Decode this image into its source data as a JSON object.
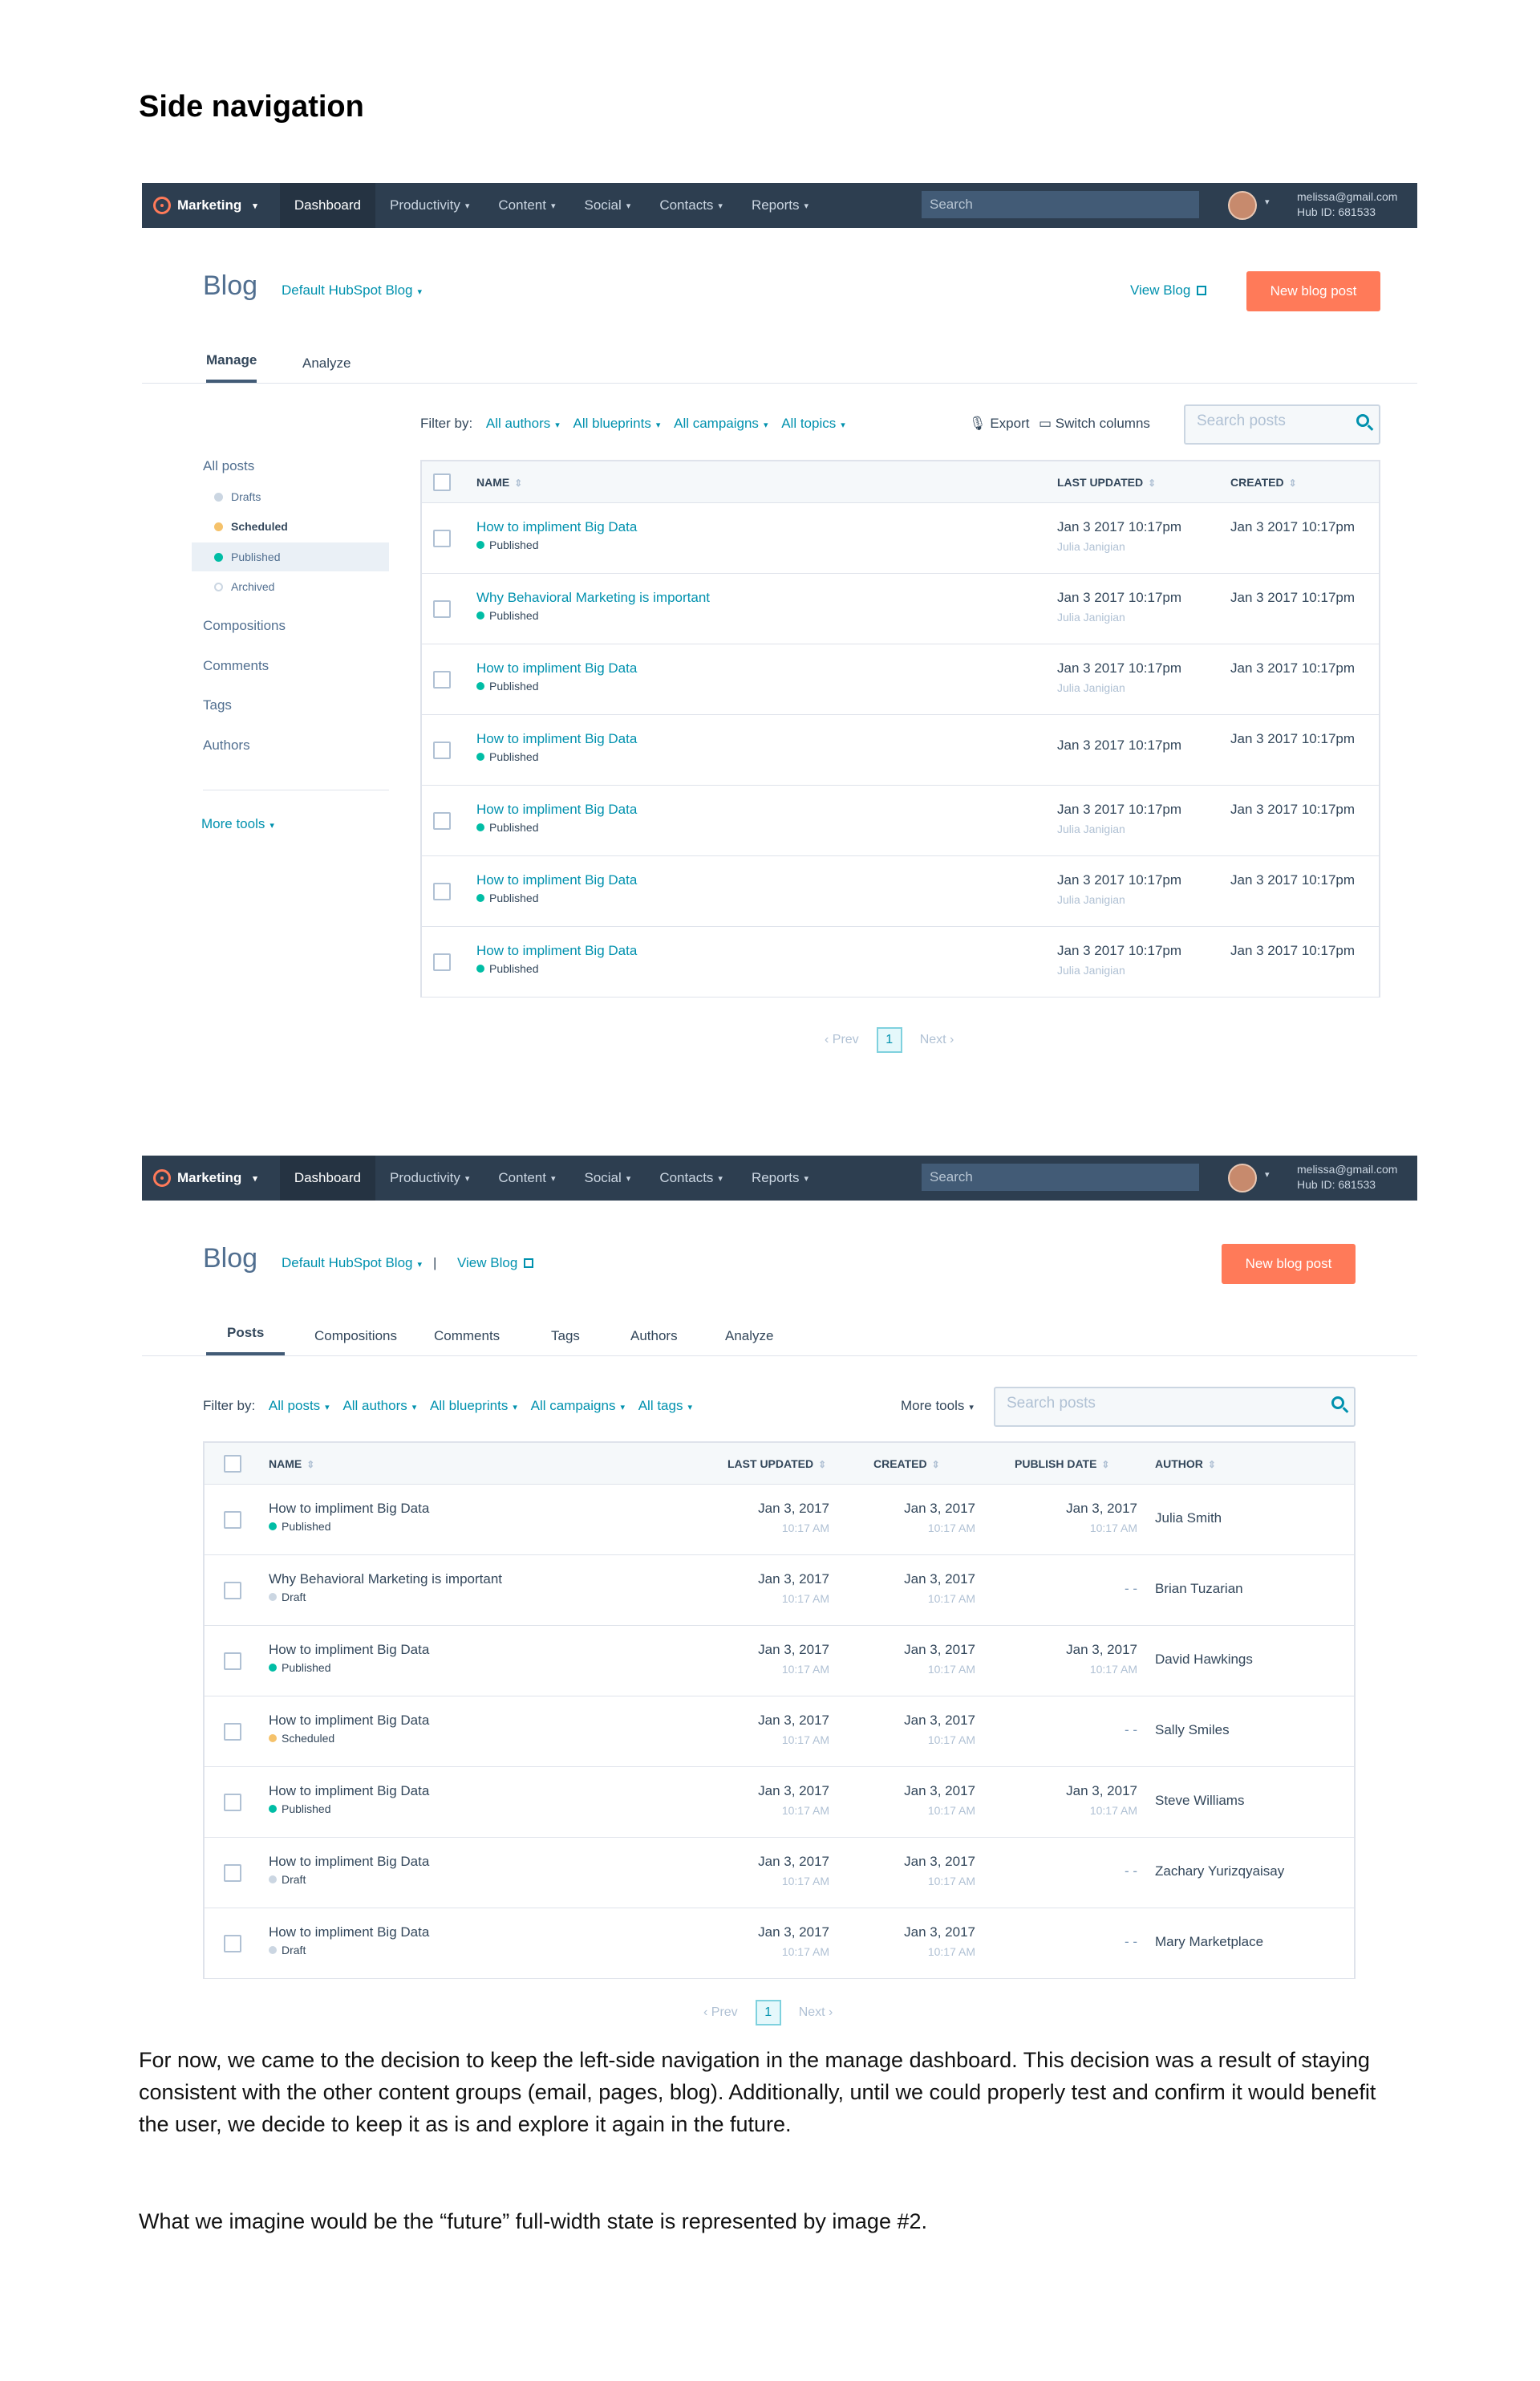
{
  "doc": {
    "heading": "Side navigation",
    "para1": "For now, we came to the decision to keep the left-side navigation in the manage dashboard. This decision was a result of staying consistent with the other content groups (email, pages, blog). Additionally, until we could properly test and confirm it would benefit the user, we decide to keep it as is and explore it again in the future.",
    "para2": "What we imagine would be the “future” full-width state is represented by image #2."
  },
  "nav": {
    "logo": "Marketing",
    "items": [
      "Dashboard",
      "Productivity",
      "Content",
      "Social",
      "Contacts",
      "Reports"
    ],
    "search": "Search",
    "email": "melissa@gmail.com",
    "hub": "Hub ID: 681533"
  },
  "colors": {
    "accent": "#ff7a59",
    "link": "#0091ae",
    "nav": "#2d3e50",
    "published": "#00bda5",
    "scheduled": "#f5c26b",
    "draft": "#cbd6e2"
  },
  "s1": {
    "title": "Blog",
    "blog_select": "Default HubSpot Blog",
    "view_blog": "View Blog",
    "new_post": "New blog post",
    "tabs": [
      "Manage",
      "Analyze"
    ],
    "sidebar": {
      "all_posts": "All posts",
      "subs": [
        "Drafts",
        "Scheduled",
        "Published",
        "Archived"
      ],
      "items": [
        "Compositions",
        "Comments",
        "Tags",
        "Authors"
      ],
      "more_tools": "More tools"
    },
    "filter_label": "Filter by:",
    "filters": [
      "All authors",
      "All blueprints",
      "All campaigns",
      "All topics"
    ],
    "export": "Export",
    "switch_columns": "Switch columns",
    "search_placeholder": "Search posts",
    "columns": [
      "NAME",
      "LAST UPDATED",
      "CREATED"
    ],
    "rows": [
      {
        "name": "How to impliment Big Data",
        "status": "Published",
        "updated": "Jan 3 2017 10:17pm",
        "author": "Julia Janigian",
        "created": "Jan 3 2017 10:17pm"
      },
      {
        "name": "Why Behavioral Marketing is important",
        "status": "Published",
        "updated": "Jan 3 2017 10:17pm",
        "author": "Julia Janigian",
        "created": "Jan 3 2017 10:17pm"
      },
      {
        "name": "How to impliment Big Data",
        "status": "Published",
        "updated": "Jan 3 2017 10:17pm",
        "author": "Julia Janigian",
        "created": "Jan 3 2017 10:17pm"
      },
      {
        "name": "How to impliment Big Data",
        "status": "Published",
        "updated": "Jan 3 2017 10:17pm",
        "author": "",
        "created": "Jan 3 2017 10:17pm"
      },
      {
        "name": "How to impliment Big Data",
        "status": "Published",
        "updated": "Jan 3 2017 10:17pm",
        "author": "Julia Janigian",
        "created": "Jan 3 2017 10:17pm"
      },
      {
        "name": "How to impliment Big Data",
        "status": "Published",
        "updated": "Jan 3 2017 10:17pm",
        "author": "Julia Janigian",
        "created": "Jan 3 2017 10:17pm"
      },
      {
        "name": "How to impliment Big Data",
        "status": "Published",
        "updated": "Jan 3 2017 10:17pm",
        "author": "Julia Janigian",
        "created": "Jan 3 2017 10:17pm"
      }
    ],
    "pager": {
      "prev": "Prev",
      "page": "1",
      "next": "Next"
    }
  },
  "s2": {
    "title": "Blog",
    "blog_select": "Default HubSpot Blog",
    "view_blog": "View Blog",
    "new_post": "New blog post",
    "tabs": [
      "Posts",
      "Compositions",
      "Comments",
      "Tags",
      "Authors",
      "Analyze"
    ],
    "filter_label": "Filter by:",
    "filters": [
      "All posts",
      "All authors",
      "All blueprints",
      "All campaigns",
      "All tags"
    ],
    "more_tools": "More tools",
    "search_placeholder": "Search posts",
    "columns": [
      "NAME",
      "LAST UPDATED",
      "CREATED",
      "PUBLISH DATE",
      "AUTHOR"
    ],
    "rows": [
      {
        "name": "How to impliment Big Data",
        "status": "Published",
        "updated": "Jan 3, 2017",
        "updated_t": "10:17 AM",
        "created": "Jan 3, 2017",
        "created_t": "10:17 AM",
        "pub": "Jan 3, 2017",
        "pub_t": "10:17 AM",
        "author": "Julia Smith"
      },
      {
        "name": "Why Behavioral Marketing is important",
        "status": "Draft",
        "updated": "Jan 3, 2017",
        "updated_t": "10:17 AM",
        "created": "Jan 3, 2017",
        "created_t": "10:17 AM",
        "pub": "- -",
        "pub_t": "",
        "author": "Brian Tuzarian"
      },
      {
        "name": "How to impliment Big Data",
        "status": "Published",
        "updated": "Jan 3, 2017",
        "updated_t": "10:17 AM",
        "created": "Jan 3, 2017",
        "created_t": "10:17 AM",
        "pub": "Jan 3, 2017",
        "pub_t": "10:17 AM",
        "author": "David Hawkings"
      },
      {
        "name": "How to impliment Big Data",
        "status": "Scheduled",
        "updated": "Jan 3, 2017",
        "updated_t": "10:17 AM",
        "created": "Jan 3, 2017",
        "created_t": "10:17 AM",
        "pub": "- -",
        "pub_t": "",
        "author": "Sally Smiles"
      },
      {
        "name": "How to impliment Big Data",
        "status": "Published",
        "updated": "Jan 3, 2017",
        "updated_t": "10:17 AM",
        "created": "Jan 3, 2017",
        "created_t": "10:17 AM",
        "pub": "Jan 3, 2017",
        "pub_t": "10:17 AM",
        "author": "Steve Williams"
      },
      {
        "name": "How to impliment Big Data",
        "status": "Draft",
        "updated": "Jan 3, 2017",
        "updated_t": "10:17 AM",
        "created": "Jan 3, 2017",
        "created_t": "10:17 AM",
        "pub": "- -",
        "pub_t": "",
        "author": "Zachary Yurizqyaisay"
      },
      {
        "name": "How to impliment Big Data",
        "status": "Draft",
        "updated": "Jan 3, 2017",
        "updated_t": "10:17 AM",
        "created": "Jan 3, 2017",
        "created_t": "10:17 AM",
        "pub": "- -",
        "pub_t": "",
        "author": "Mary Marketplace"
      }
    ],
    "pager": {
      "prev": "Prev",
      "page": "1",
      "next": "Next"
    }
  }
}
